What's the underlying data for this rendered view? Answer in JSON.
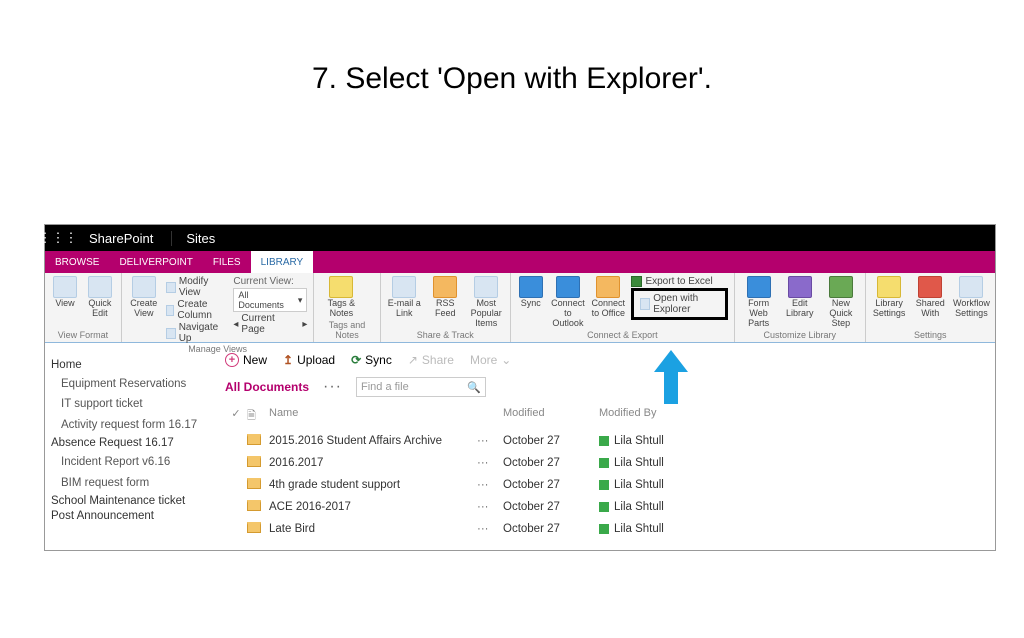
{
  "slide": {
    "title": "7. Select 'Open with Explorer'."
  },
  "topbar": {
    "sharepoint": "SharePoint",
    "sites": "Sites"
  },
  "tabs": [
    "BROWSE",
    "DELIVERPOINT",
    "FILES",
    "LIBRARY"
  ],
  "ribbon": {
    "view_format": {
      "label": "View Format",
      "view": "View",
      "quick": "Quick\nEdit"
    },
    "manage_views": {
      "label": "Manage Views",
      "create": "Create\nView",
      "modify": "Modify View",
      "create_col": "Create Column",
      "nav": "Navigate Up",
      "cv_label": "Current View:",
      "cv_value": "All Documents",
      "cv_page": "Current Page"
    },
    "tags_notes": {
      "label": "Tags and Notes",
      "tags": "Tags &\nNotes"
    },
    "share_track": {
      "label": "Share & Track",
      "email": "E-mail a\nLink",
      "rss": "RSS\nFeed",
      "pop": "Most Popular\nItems"
    },
    "connect_export": {
      "label": "Connect & Export",
      "sync": "Sync",
      "outlook": "Connect to\nOutlook",
      "office": "Connect to\nOffice",
      "export": "Export to Excel",
      "open": "Open with Explorer"
    },
    "customize": {
      "label": "Customize Library",
      "form": "Form Web\nParts",
      "edit": "Edit\nLibrary",
      "nq": "New Quick\nStep"
    },
    "settings": {
      "label": "Settings",
      "lib": "Library\nSettings",
      "shared": "Shared\nWith",
      "wf": "Workflow\nSettings"
    }
  },
  "commands": {
    "new": "New",
    "upload": "Upload",
    "sync": "Sync",
    "share": "Share",
    "more": "More"
  },
  "view": {
    "name": "All Documents",
    "search_placeholder": "Find a file"
  },
  "columns": {
    "name": "Name",
    "modified": "Modified",
    "by": "Modified By"
  },
  "sidebar": {
    "home": "Home",
    "links1": [
      "Equipment Reservations",
      "IT support ticket",
      "Activity request form 16.17"
    ],
    "group": "Absence Request 16.17",
    "links2": [
      "Incident Report v6.16",
      "BIM request form"
    ],
    "tail": [
      "School Maintenance ticket",
      "Post Announcement"
    ]
  },
  "rows": [
    {
      "name": "2015.2016 Student Affairs Archive",
      "mod": "October 27",
      "by": "Lila Shtull"
    },
    {
      "name": "2016.2017",
      "mod": "October 27",
      "by": "Lila Shtull"
    },
    {
      "name": "4th grade student support",
      "mod": "October 27",
      "by": "Lila Shtull"
    },
    {
      "name": "ACE 2016-2017",
      "mod": "October 27",
      "by": "Lila Shtull"
    },
    {
      "name": "Late Bird",
      "mod": "October 27",
      "by": "Lila Shtull"
    }
  ]
}
